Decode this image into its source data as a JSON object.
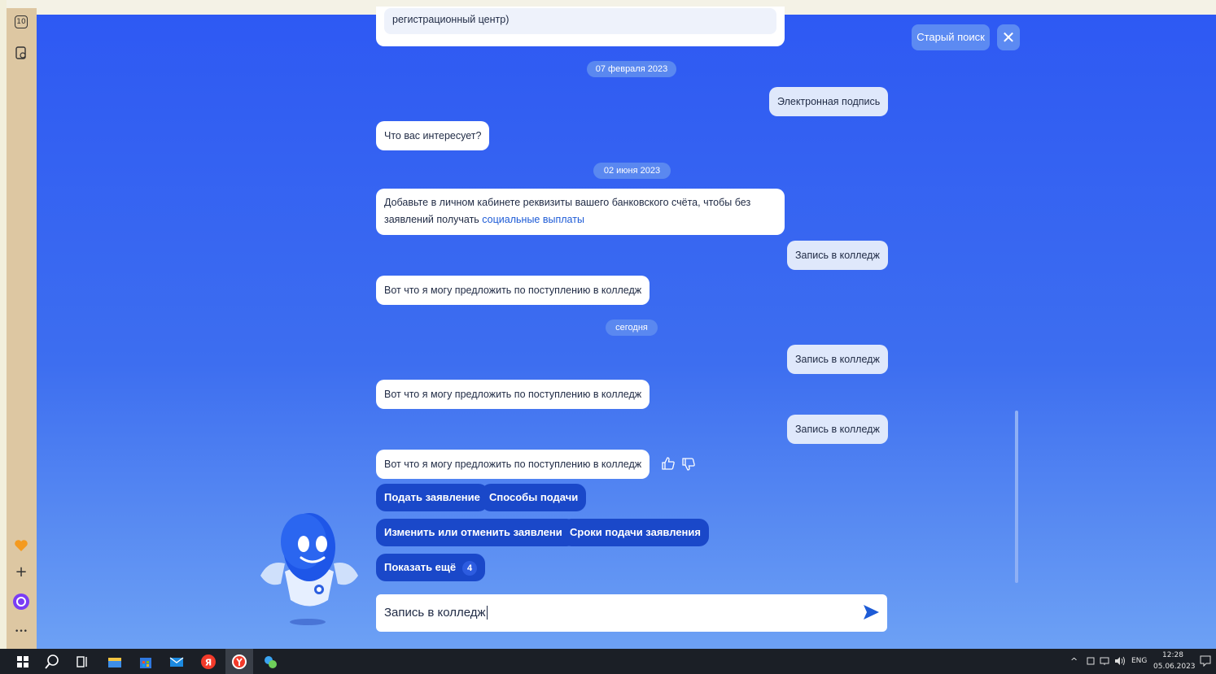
{
  "chat": {
    "messages": {
      "top_partial": "регистрационный центр)",
      "date1": "07 февраля 2023",
      "user1": "Электронная подпись",
      "bot1": "Что вас интересует?",
      "date2": "02 июня 2023",
      "bot2_line1": "Добавьте в личном кабинете реквизиты вашего банковского счёта, чтобы без",
      "bot2_line2_prefix": "заявлений получать",
      "bot2_link": "социальные выплаты",
      "user2": "Запись в колледж",
      "bot3": "Вот что я могу предложить по поступлению в колледж",
      "date3": "сегодня",
      "user3": "Запись в колледж",
      "bot4": "Вот что я могу предложить по поступлению в колледж",
      "user4": "Запись в колледж",
      "bot5": "Вот что я могу предложить по поступлению в колледж"
    },
    "quick_replies": {
      "submit": "Подать заявление",
      "methods": "Способы подачи",
      "change": "Изменить или отменить заявление",
      "deadlines": "Сроки подачи заявления",
      "more": "Показать ещё",
      "more_count": "4"
    },
    "input_value": "Запись в колледж"
  },
  "header": {
    "old_search": "Старый поиск",
    "close": "✕"
  },
  "sidebar": {
    "tabs_count": "10",
    "more": "•••"
  },
  "taskbar": {
    "lang": "ENG",
    "time": "12:28",
    "date": "05.06.2023"
  },
  "colors": {
    "accent": "#2e59f3",
    "chip": "#1a48c9",
    "link": "#1d5bd6"
  }
}
